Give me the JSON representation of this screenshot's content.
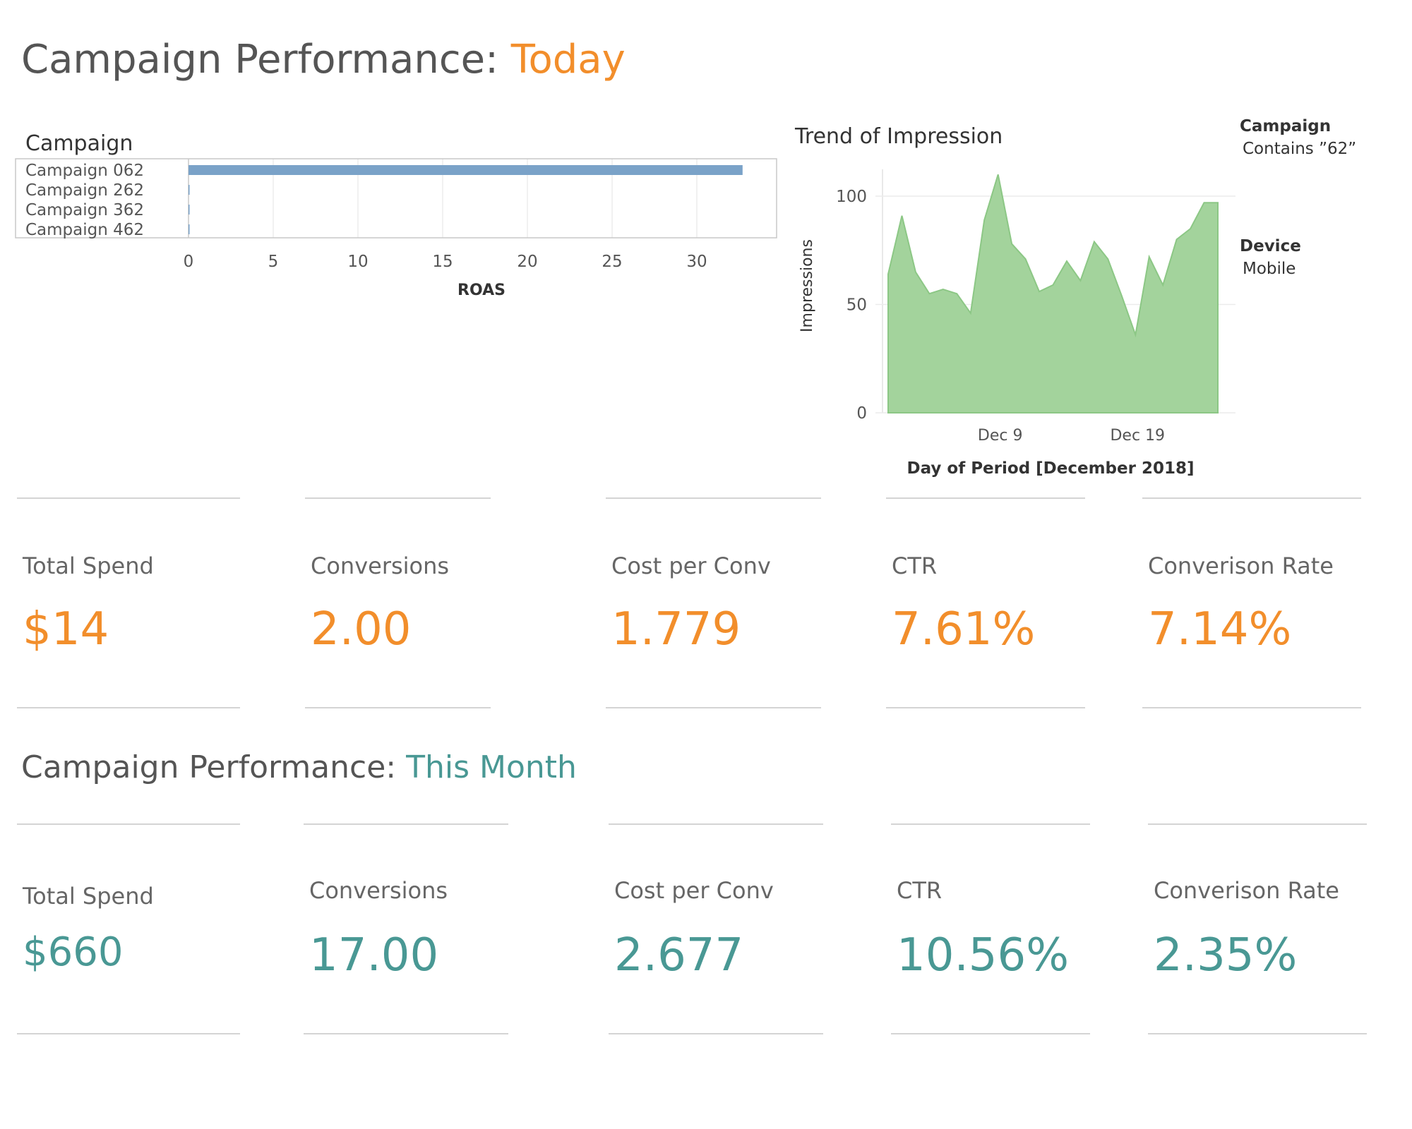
{
  "header": {
    "today_prefix": "Campaign Performance: ",
    "today_accent": "Today",
    "month_prefix": "Campaign Performance: ",
    "month_accent": "This Month"
  },
  "colors": {
    "today_accent": "#f28e2b",
    "month_accent": "#499894",
    "bar": "#7aa2c8",
    "area": "#a3d39c",
    "area_line": "#8cc785"
  },
  "filters": {
    "campaign_title": "Campaign",
    "campaign_value": "Contains ”62”",
    "device_title": "Device",
    "device_value": "Mobile"
  },
  "chart_data": [
    {
      "type": "bar",
      "orientation": "horizontal",
      "row_header": "Campaign",
      "categories": [
        "Campaign 062",
        "Campaign 262",
        "Campaign 362",
        "Campaign 462"
      ],
      "values": [
        32.7,
        0,
        0,
        0
      ],
      "xlabel": "ROAS",
      "xticks": [
        0,
        5,
        10,
        15,
        20,
        25,
        30
      ],
      "xlim": [
        0,
        35
      ],
      "grid": true
    },
    {
      "type": "area",
      "title": "Trend of Impression",
      "xlabel": "Day of Period [December 2018]",
      "ylabel": "Impressions",
      "x": [
        "2018-12-01",
        "2018-12-02",
        "2018-12-03",
        "2018-12-04",
        "2018-12-05",
        "2018-12-06",
        "2018-12-07",
        "2018-12-08",
        "2018-12-09",
        "2018-12-10",
        "2018-12-11",
        "2018-12-12",
        "2018-12-13",
        "2018-12-14",
        "2018-12-15",
        "2018-12-16",
        "2018-12-17",
        "2018-12-18",
        "2018-12-19",
        "2018-12-20",
        "2018-12-21",
        "2018-12-22",
        "2018-12-23",
        "2018-12-24",
        "2018-12-25"
      ],
      "values": [
        64,
        91,
        65,
        55,
        57,
        55,
        46,
        89,
        110,
        78,
        71,
        56,
        59,
        70,
        61,
        79,
        71,
        54,
        36,
        72,
        59,
        80,
        85,
        97,
        97
      ],
      "xticks": [
        "Dec 9",
        "Dec 19"
      ],
      "yticks": [
        0,
        50,
        100
      ],
      "ylim": [
        0,
        115
      ],
      "grid": true
    }
  ],
  "kpi_today": [
    {
      "label": "Total Spend",
      "value": "$14"
    },
    {
      "label": "Conversions",
      "value": "2.00"
    },
    {
      "label": "Cost per Conv",
      "value": "1.779"
    },
    {
      "label": "CTR",
      "value": "7.61%"
    },
    {
      "label": "Converison Rate",
      "value": "7.14%"
    }
  ],
  "kpi_month": [
    {
      "label": "Total Spend",
      "value": "$660"
    },
    {
      "label": "Conversions",
      "value": "17.00"
    },
    {
      "label": "Cost per Conv",
      "value": "2.677"
    },
    {
      "label": "CTR",
      "value": "10.56%"
    },
    {
      "label": "Converison Rate",
      "value": "2.35%"
    }
  ]
}
